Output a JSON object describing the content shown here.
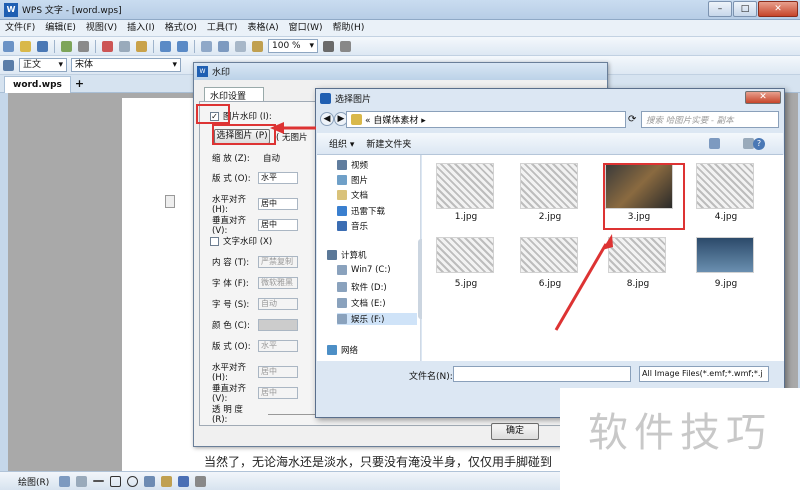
{
  "app": {
    "title": "WPS 文字 - [word.wps]"
  },
  "menu": [
    "文件(F)",
    "编辑(E)",
    "视图(V)",
    "插入(I)",
    "格式(O)",
    "工具(T)",
    "表格(A)",
    "窗口(W)",
    "帮助(H)"
  ],
  "toolbar": {
    "zoom": "100 %",
    "style": "正文",
    "font": "宋体"
  },
  "tabs": {
    "doc": "word.wps",
    "add": "+"
  },
  "doc": {
    "body_text": "当然了，无论海水还是淡水，只要没有淹没半身，仅仅用手脚碰到"
  },
  "drawbar": {
    "label": "绘图(R)"
  },
  "watermark": {
    "title": "水印",
    "tab": "水印设置",
    "pic_watermark": "图片水印 (I):",
    "select_btn": "选择图片 (P)",
    "no_pic": "( 无图片",
    "scale_label": "缩 放 (Z):",
    "scale_value": "自动",
    "layout_label": "版 式 (O):",
    "layout_value": "水平",
    "halign_label": "水平对齐 (H):",
    "halign_value": "居中",
    "valign_label": "垂直对齐 (V):",
    "valign_value": "居中",
    "text_watermark": "文字水印 (X)",
    "content_label": "内 容 (T):",
    "content_value": "严禁复制",
    "font_label": "字 体 (F):",
    "font_value": "微软雅黑",
    "size_label": "字 号 (S):",
    "size_value": "自动",
    "color_label": "颜 色 (C):",
    "tlayout_label": "版 式 (O):",
    "tlayout_value": "水平",
    "thalign_label": "水平对齐 (H):",
    "thalign_value": "居中",
    "tvalign_label": "垂直对齐 (V):",
    "tvalign_value": "居中",
    "opacity_label": "透 明 度 (R):",
    "ok": "确定"
  },
  "file_dialog": {
    "title": "选择图片",
    "path": "« 自媒体素材 ▸",
    "search_placeholder": "搜索 哈图片实要 - 副本",
    "organize": "组织 ▾",
    "new_folder": "新建文件夹",
    "nav": [
      {
        "label": "视频",
        "icon": "video-icon"
      },
      {
        "label": "图片",
        "icon": "picture-icon"
      },
      {
        "label": "文档",
        "icon": "document-icon"
      },
      {
        "label": "迅雷下载",
        "icon": "download-icon"
      },
      {
        "label": "音乐",
        "icon": "music-icon"
      },
      {
        "label": "计算机",
        "icon": "computer-icon"
      },
      {
        "label": "Win7 (C:)",
        "icon": "drive-icon"
      },
      {
        "label": "软件 (D:)",
        "icon": "drive-icon"
      },
      {
        "label": "文档 (E:)",
        "icon": "drive-icon"
      },
      {
        "label": "娱乐 (F:)",
        "icon": "drive-icon"
      },
      {
        "label": "网络",
        "icon": "network-icon"
      }
    ],
    "files": [
      "1.jpg",
      "2.jpg",
      "3.jpg",
      "4.jpg",
      "5.jpg",
      "6.jpg",
      "8.jpg",
      "9.jpg"
    ],
    "filename_label": "文件名(N):",
    "filter": "All Image Files(*.emf;*.wmf;*.j"
  },
  "overlay": {
    "text": "软件技巧"
  },
  "colors": {
    "highlight": "#dd3333",
    "accent": "#1f5fb2"
  }
}
